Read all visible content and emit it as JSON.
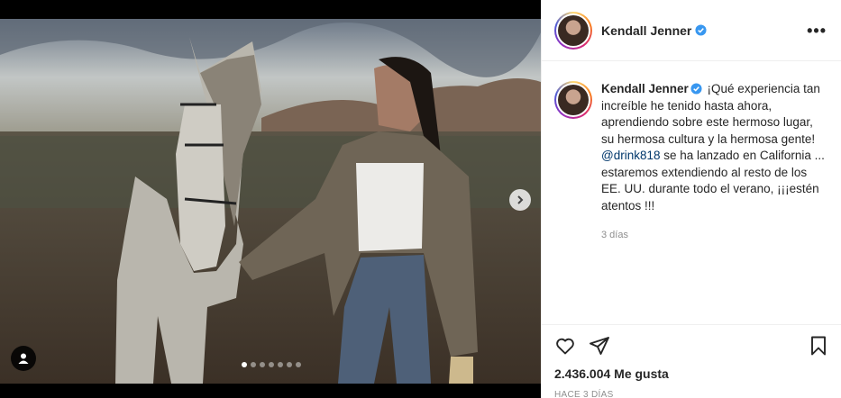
{
  "post": {
    "username": "Kendall Jenner",
    "caption_p1": "¡Qué experiencia tan increíble he tenido hasta ahora, aprendiendo sobre este hermoso lugar, su hermosa cultura y la hermosa gente!",
    "mention": "@drink818",
    "caption_p2": " se ha lanzado en California ... estaremos extendiendo al resto de los EE. UU. durante todo el verano, ¡¡¡estén atentos !!!",
    "caption_time": "3 días",
    "likes": "2.436.004 Me gusta",
    "date": "HACE 3 DÍAS"
  },
  "carousel": {
    "current": 1,
    "total": 7
  },
  "icons": {
    "like": "heart-icon",
    "share": "share-icon",
    "save": "bookmark-icon",
    "next": "chevron-right-icon",
    "tags": "user-tag-icon",
    "more": "more-icon",
    "verified": "verified-badge-icon"
  },
  "colors": {
    "verified": "#3897f0",
    "mention": "#00376b",
    "text": "#262626",
    "muted": "#8e8e8e"
  }
}
